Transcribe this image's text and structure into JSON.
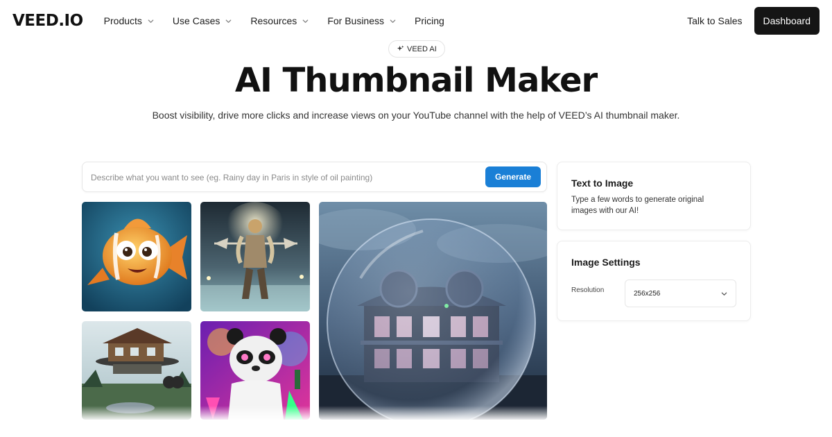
{
  "nav": {
    "logo": "VEED.IO",
    "items": [
      {
        "label": "Products",
        "has_dropdown": true
      },
      {
        "label": "Use Cases",
        "has_dropdown": true
      },
      {
        "label": "Resources",
        "has_dropdown": true
      },
      {
        "label": "For Business",
        "has_dropdown": true
      },
      {
        "label": "Pricing",
        "has_dropdown": false
      }
    ],
    "talk_to_sales": "Talk to Sales",
    "dashboard": "Dashboard"
  },
  "hero": {
    "badge": "VEED AI",
    "badge_icon": "sparkle-icon",
    "title": "AI Thumbnail Maker",
    "subtitle": "Boost visibility, drive more clicks and increase views on your YouTube channel with the help of VEED’s AI thumbnail maker."
  },
  "prompt": {
    "placeholder": "Describe what you want to see (eg. Rainy day in Paris in style of oil painting)",
    "value": "",
    "generate": "Generate"
  },
  "gallery": {
    "images": [
      "cartoon-fish",
      "armored-warrior",
      "glass-dome-house",
      "floating-house",
      "neon-panda-scientist"
    ]
  },
  "panels": {
    "text_to_image": {
      "title": "Text to Image",
      "description": "Type a few words to generate original images with our AI!"
    },
    "image_settings": {
      "title": "Image Settings",
      "resolution_label": "Resolution",
      "resolution_value": "256x256"
    }
  },
  "colors": {
    "accent": "#1a7fd6",
    "dark_button": "#151515"
  }
}
